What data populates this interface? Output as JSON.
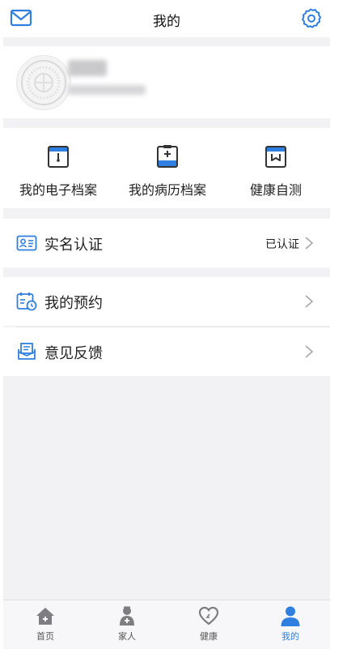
{
  "header": {
    "title": "我的"
  },
  "icons": {
    "mail": "mail-icon",
    "settings": "gear-icon"
  },
  "quick_actions": [
    {
      "label": "我的电子档案",
      "icon": "e-record-icon"
    },
    {
      "label": "我的病历档案",
      "icon": "medical-record-icon"
    },
    {
      "label": "健康自测",
      "icon": "health-test-icon"
    }
  ],
  "menu": {
    "real_name": {
      "label": "实名认证",
      "status": "已认证"
    },
    "appointment": {
      "label": "我的预约"
    },
    "feedback": {
      "label": "意见反馈"
    }
  },
  "tabbar": {
    "items": [
      {
        "label": "首页",
        "icon": "home-icon"
      },
      {
        "label": "家人",
        "icon": "family-doctor-icon"
      },
      {
        "label": "健康",
        "icon": "heart-icon"
      },
      {
        "label": "我的",
        "icon": "person-icon"
      }
    ],
    "active_index": 3
  },
  "colors": {
    "accent": "#2f7fe0",
    "background": "#f2f2f5",
    "text": "#222222"
  }
}
